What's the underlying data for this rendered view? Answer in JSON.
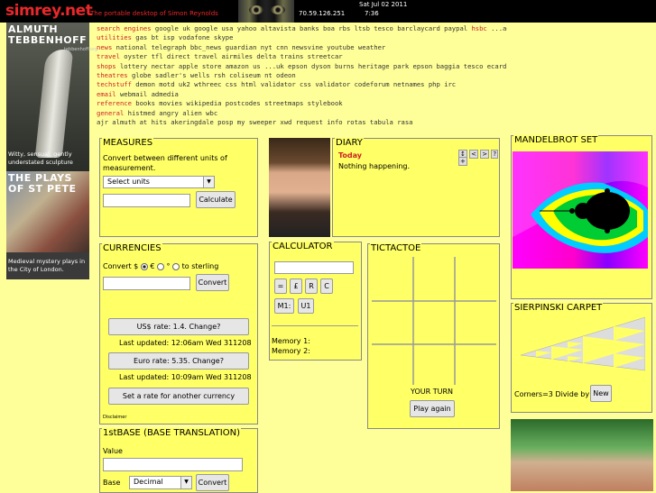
{
  "header": {
    "logo": "simrey.net",
    "tagline": "The portable desktop of Simon Reynolds",
    "ip": "70.59.126.251",
    "date": "Sat Jul 02 2011",
    "time": "7:36"
  },
  "ads": {
    "ad1_title_a": "ALMUTH",
    "ad1_title_b": "TEBBENHOFF",
    "ad1_small": "tebbenhoff.org",
    "ad1_text_a": "Witty, sensual, gently",
    "ad1_text_b": "understated sculpture",
    "ad2_title_a": "THE PLAYS",
    "ad2_title_b": "OF ST PETE",
    "ad2_text_a": "Medieval mystery plays in",
    "ad2_text_b": "the City of London."
  },
  "links": [
    {
      "cat": "search engines",
      "items": "google uk google usa yahoo altavista banks boa rbs ltsb tesco barclaycard paypal",
      "hl": "hsbc",
      "rest": "...ae ...uk"
    },
    {
      "cat": "utilities",
      "items": "gas bt isp vodafone skype",
      "hl": "",
      "rest": ""
    },
    {
      "cat": "news",
      "items": "national telegraph bbc_news guardian nyt cnn newsvine youtube weather",
      "hl": "",
      "rest": ""
    },
    {
      "cat": "travel",
      "items": "oyster tfl direct travel airmiles delta trains streetcar",
      "hl": "",
      "rest": ""
    },
    {
      "cat": "shops",
      "items": "lottery nectar apple store amazon us ...uk epson dyson burns heritage park epson baggia tesco ecards",
      "hl": "",
      "rest": ""
    },
    {
      "cat": "theatres",
      "items": "globe sadler's wells rsh coliseum nt odeon",
      "hl": "",
      "rest": ""
    },
    {
      "cat": "techstuff",
      "items": "demon motd uk2 wthreec css html validator css validator codeforum netnames php irc",
      "hl": "",
      "rest": ""
    },
    {
      "cat": "email",
      "items": "webmail admedia",
      "hl": "",
      "rest": ""
    },
    {
      "cat": "reference",
      "items": "books movies wikipedia postcodes streetmaps stylebook",
      "hl": "",
      "rest": ""
    },
    {
      "cat": "general",
      "items": "histmed angry alien wbc",
      "hl": "",
      "rest": ""
    },
    {
      "cat": "",
      "items": "ajr almuth at hits akeringdale posp my sweeper xwd request info rotas tabula rasa",
      "hl": "",
      "rest": ""
    }
  ],
  "measures": {
    "title": "MEASURES",
    "desc_a": "Convert between different units of",
    "desc_b": "measurement.",
    "select_value": "Select units",
    "calculate": "Calculate"
  },
  "currencies": {
    "title": "CURRENCIES",
    "convert_label": "Convert $",
    "euro": "€",
    "other": "°",
    "to_sterling": "to sterling",
    "convert": "Convert",
    "us_rate": "US$ rate: 1.4. Change?",
    "us_updated": "Last updated: 12:06am Wed 311208",
    "euro_rate": "Euro rate: 5.35. Change?",
    "euro_updated": "Last updated: 10:09am Wed 311208",
    "set_rate": "Set a rate for another currency",
    "disclaimer": "Disclaimer"
  },
  "base": {
    "title": "1stBASE (BASE TRANSLATION)",
    "value_label": "Value",
    "base_label": "Base",
    "select_value": "Decimal",
    "convert": "Convert"
  },
  "diary": {
    "title": "DIARY",
    "today": "Today",
    "message": "Nothing happening.",
    "nav": [
      "↕",
      "<",
      ">",
      "?",
      "+"
    ]
  },
  "calculator": {
    "title": "CALCULATOR",
    "keys": [
      "=",
      "£",
      "R",
      "C"
    ],
    "m1": "M1:",
    "u1": "U1",
    "memory1": "Memory 1:",
    "memory2": "Memory 2:"
  },
  "tictactoe": {
    "title": "TICTACTOE",
    "status": "YOUR TURN",
    "play_again": "Play again"
  },
  "mandelbrot": {
    "title": "MANDELBROT SET"
  },
  "sierpinski": {
    "title": "SIERPINSKI CARPET",
    "corners": "Corners=3 Divide by 2",
    "new": "New"
  }
}
